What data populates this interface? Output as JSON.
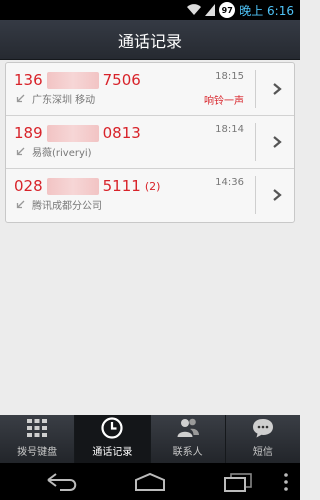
{
  "status_bar": {
    "battery": "97",
    "time": "晚上 6:16",
    "time_color": "#4fc3f7"
  },
  "header": {
    "title": "通话记录"
  },
  "accent_color": "#d8232a",
  "calls": [
    {
      "number_prefix": "136",
      "number_suffix": "7506",
      "count": "",
      "location": "广东深圳 移动",
      "time": "18:15",
      "status": "响铃一声",
      "type_icon": "missed-call-icon"
    },
    {
      "number_prefix": "189",
      "number_suffix": "0813",
      "count": "",
      "location": "易薇(riveryi)",
      "time": "18:14",
      "status": "",
      "type_icon": "missed-call-icon"
    },
    {
      "number_prefix": "028",
      "number_suffix": "5111",
      "count": "(2)",
      "location": "腾讯成都分公司",
      "time": "14:36",
      "status": "",
      "type_icon": "missed-call-icon"
    }
  ],
  "tabs": [
    {
      "label": "拨号键盘",
      "icon": "dialpad-icon",
      "active": false
    },
    {
      "label": "通话记录",
      "icon": "clock-icon",
      "active": true
    },
    {
      "label": "联系人",
      "icon": "contacts-icon",
      "active": false
    },
    {
      "label": "短信",
      "icon": "message-icon",
      "active": false
    }
  ],
  "nav": {
    "back_icon": "back-icon",
    "home_icon": "home-icon",
    "recent_icon": "recent-apps-icon",
    "menu_icon": "overflow-menu-icon"
  }
}
